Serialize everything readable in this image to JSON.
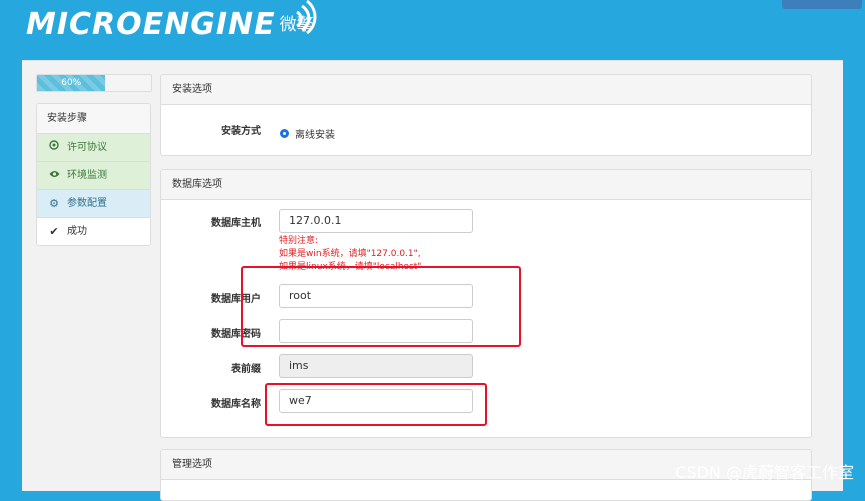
{
  "brand": {
    "logo_text": "MICROENGINE",
    "logo_cn": "微擎"
  },
  "progress": {
    "label": "60%",
    "value": 0.6
  },
  "steps": {
    "title": "安装步骤",
    "items": [
      {
        "label": "许可协议",
        "status": "done",
        "icon": "copyright-icon"
      },
      {
        "label": "环境监测",
        "status": "done",
        "icon": "eye-icon"
      },
      {
        "label": "参数配置",
        "status": "active",
        "icon": "gear-icon"
      },
      {
        "label": "成功",
        "status": "todo",
        "icon": "check-icon"
      }
    ]
  },
  "install_options": {
    "title": "安装选项",
    "method_label": "安装方式",
    "method_value": "离线安装"
  },
  "database": {
    "title": "数据库选项",
    "host_label": "数据库主机",
    "host_value": "127.0.0.1",
    "notice_line1": "特别注意:",
    "notice_line2": "如果是win系统，请填\"127.0.0.1\",",
    "notice_line3": "如果是linux系统，请填\"localhost\"",
    "user_label": "数据库用户",
    "user_value": "root",
    "password_label": "数据库密码",
    "password_value": "",
    "prefix_label": "表前缀",
    "prefix_value": "ims",
    "name_label": "数据库名称",
    "name_value": "we7"
  },
  "admin_options": {
    "title": "管理选项"
  },
  "watermark": "CSDN @虎蔚智客工作室",
  "colors": {
    "header_bg": "#26a7de",
    "annotation": "#e8102a",
    "active_step": "#d9edf7",
    "done_step": "#dff0d8"
  }
}
